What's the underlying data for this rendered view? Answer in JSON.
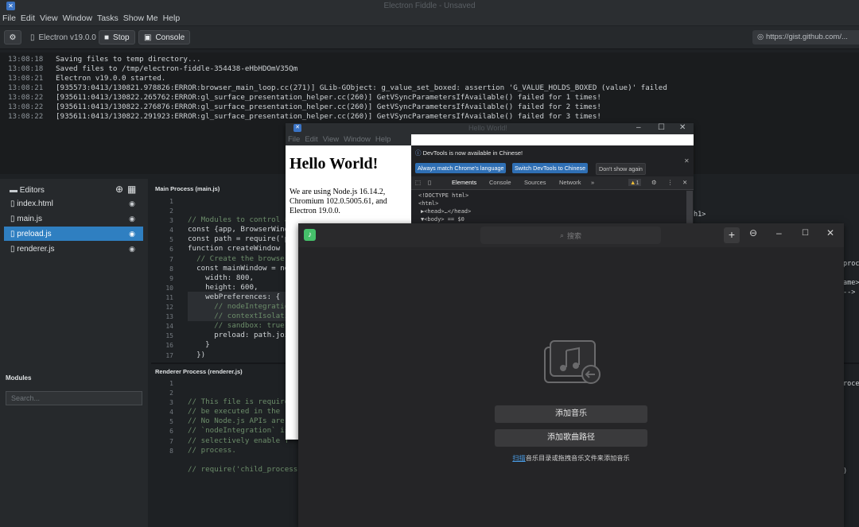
{
  "app": {
    "title": "Electron Fiddle - Unsaved",
    "menu": [
      "File",
      "Edit",
      "View",
      "Window",
      "Tasks",
      "Show Me",
      "Help"
    ]
  },
  "toolbar": {
    "version": "Electron v19.0.0",
    "stop": "Stop",
    "console": "Console",
    "gist_url": "https://gist.github.com/..."
  },
  "console": {
    "lines": [
      {
        "ts": "13:08:18",
        "text": "Saving files to temp directory..."
      },
      {
        "ts": "13:08:18",
        "text": "Saved files to /tmp/electron-fiddle-354438-eHbHDOmV35Qm"
      },
      {
        "ts": "13:08:21",
        "text": "Electron v19.0.0 started."
      },
      {
        "ts": "13:08:21",
        "text": "[935573:0413/130821.978826:ERROR:browser_main_loop.cc(271)] GLib-GObject: g_value_set_boxed: assertion 'G_VALUE_HOLDS_BOXED (value)' failed"
      },
      {
        "ts": "13:08:22",
        "text": "[935611:0413/130822.265762:ERROR:gl_surface_presentation_helper.cc(260)] GetVSyncParametersIfAvailable() failed for 1 times!"
      },
      {
        "ts": "13:08:22",
        "text": "[935611:0413/130822.276876:ERROR:gl_surface_presentation_helper.cc(260)] GetVSyncParametersIfAvailable() failed for 2 times!"
      },
      {
        "ts": "13:08:22",
        "text": "[935611:0413/130822.291923:ERROR:gl_surface_presentation_helper.cc(260)] GetVSyncParametersIfAvailable() failed for 3 times!"
      }
    ]
  },
  "sidebar": {
    "editors_label": "Editors",
    "items": [
      {
        "label": "index.html"
      },
      {
        "label": "main.js"
      },
      {
        "label": "preload.js"
      },
      {
        "label": "renderer.js"
      }
    ],
    "modules_title": "Modules",
    "search_placeholder": "Search..."
  },
  "main_editor": {
    "title": "Main Process (main.js)",
    "line_numbers": [
      "1",
      "2",
      "3",
      "4",
      "5",
      "6",
      "7",
      "8",
      "9",
      "10",
      "11",
      "12",
      "13",
      "14",
      "15",
      "16",
      "17"
    ],
    "lines": [
      "// Modules to control a",
      "const {app, BrowserWind",
      "const path = require('p",
      "",
      "function createWindow (",
      "  // Create the browser",
      "  const mainWindow = ne",
      "    width: 800,",
      "    height: 600,",
      "    webPreferences: {",
      "      // nodeIntegratio",
      "      // contextIsolati",
      "      // sandbox: true,",
      "      preload: path.joi",
      "    }",
      "  })",
      ""
    ]
  },
  "renderer_editor": {
    "title": "Renderer Process (renderer.js)",
    "line_numbers": [
      "1",
      "2",
      "3",
      "4",
      "5",
      "6",
      "7",
      "8"
    ],
    "lines": [
      "// This file is require",
      "// be executed in the r",
      "// No Node.js APIs are",
      "// `nodeIntegration` is",
      "// selectively enable f",
      "// process.",
      "",
      "// require('child_process'"
    ]
  },
  "hello_window": {
    "title": "Hello World!",
    "menu": [
      "File",
      "Edit",
      "View",
      "Window",
      "Help"
    ],
    "heading": "Hello World!",
    "paragraph": "We are using Node.js 16.14.2, Chromium 102.0.5005.61, and Electron 19.0.0."
  },
  "devtools": {
    "info": "DevTools is now available in Chinese!",
    "btn_match": "Always match Chrome's language",
    "btn_switch": "Switch DevTools to Chinese",
    "btn_dont": "Don't show again",
    "tabs": [
      "Elements",
      "Console",
      "Sources",
      "Network",
      "»"
    ],
    "issues": "1",
    "dom": [
      "<!DOCTYPE html>",
      "<html>",
      "▶<head>…</head>",
      "▼<body> == $0"
    ]
  },
  "music": {
    "search_placeholder": "搜索",
    "add_music": "添加音乐",
    "add_path": "添加歌曲路径",
    "hint_link": "扫描",
    "hint_text": "音乐目录或拖拽音乐文件来添加音乐"
  },
  "right_editor": {
    "fragments": [
      "h1>",
      "proc",
      "ame>",
      "-->",
      "roce",
      ")"
    ]
  },
  "colors": {
    "accent": "#2f7fc1",
    "music_green": "#45c06a",
    "devtools_blue": "#2f6fb4"
  }
}
